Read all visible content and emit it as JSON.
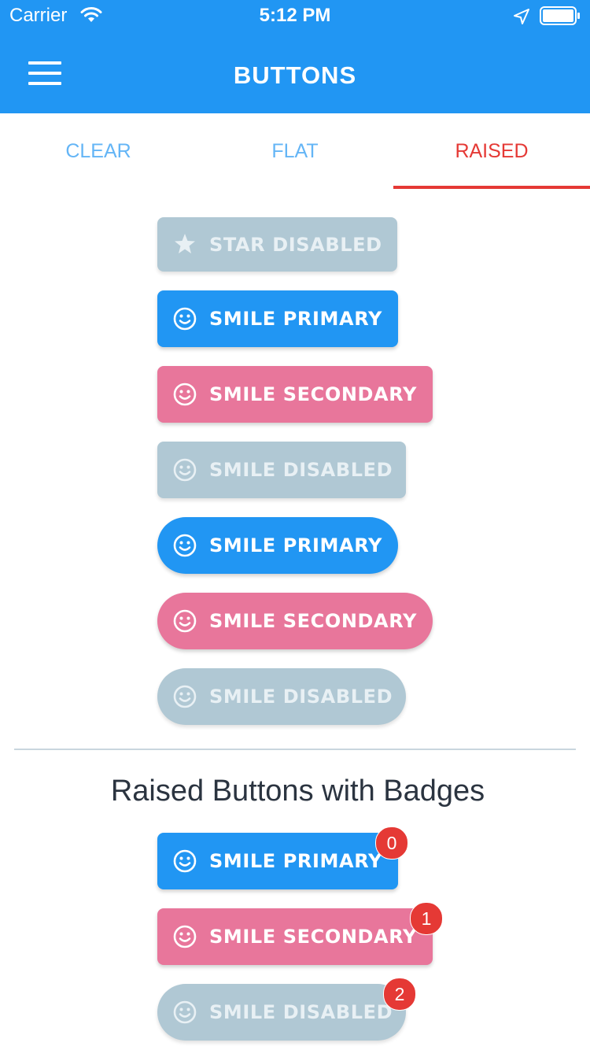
{
  "status_bar": {
    "carrier": "Carrier",
    "time": "5:12 PM",
    "icons": [
      "wifi-icon",
      "location-arrow-icon",
      "battery-icon"
    ]
  },
  "nav": {
    "title": "BUTTONS",
    "menu_icon": "hamburger-menu-icon"
  },
  "tabs": [
    {
      "label": "CLEAR"
    },
    {
      "label": "FLAT"
    },
    {
      "label": "RAISED",
      "active": true
    }
  ],
  "colors": {
    "primary": "#2196f3",
    "secondary": "#e8769b",
    "disabled": "#b0c8d4",
    "accent": "#e53935"
  },
  "buttons": {
    "partial_top": {
      "label": "STAR DISABLED",
      "icon": "star-icon"
    },
    "square": [
      {
        "label": "SMILE PRIMARY",
        "icon": "smile-icon"
      },
      {
        "label": "SMILE SECONDARY",
        "icon": "smile-icon"
      },
      {
        "label": "SMILE DISABLED",
        "icon": "smile-icon"
      }
    ],
    "rounded": [
      {
        "label": "SMILE PRIMARY",
        "icon": "smile-icon"
      },
      {
        "label": "SMILE SECONDARY",
        "icon": "smile-icon"
      },
      {
        "label": "SMILE DISABLED",
        "icon": "smile-icon"
      }
    ]
  },
  "badges_section": {
    "title": "Raised Buttons with Badges",
    "buttons": [
      {
        "label": "SMILE PRIMARY",
        "icon": "smile-icon",
        "badge": "0"
      },
      {
        "label": "SMILE SECONDARY",
        "icon": "smile-icon",
        "badge": "1"
      },
      {
        "label": "SMILE DISABLED",
        "icon": "smile-icon",
        "badge": "2"
      }
    ]
  }
}
